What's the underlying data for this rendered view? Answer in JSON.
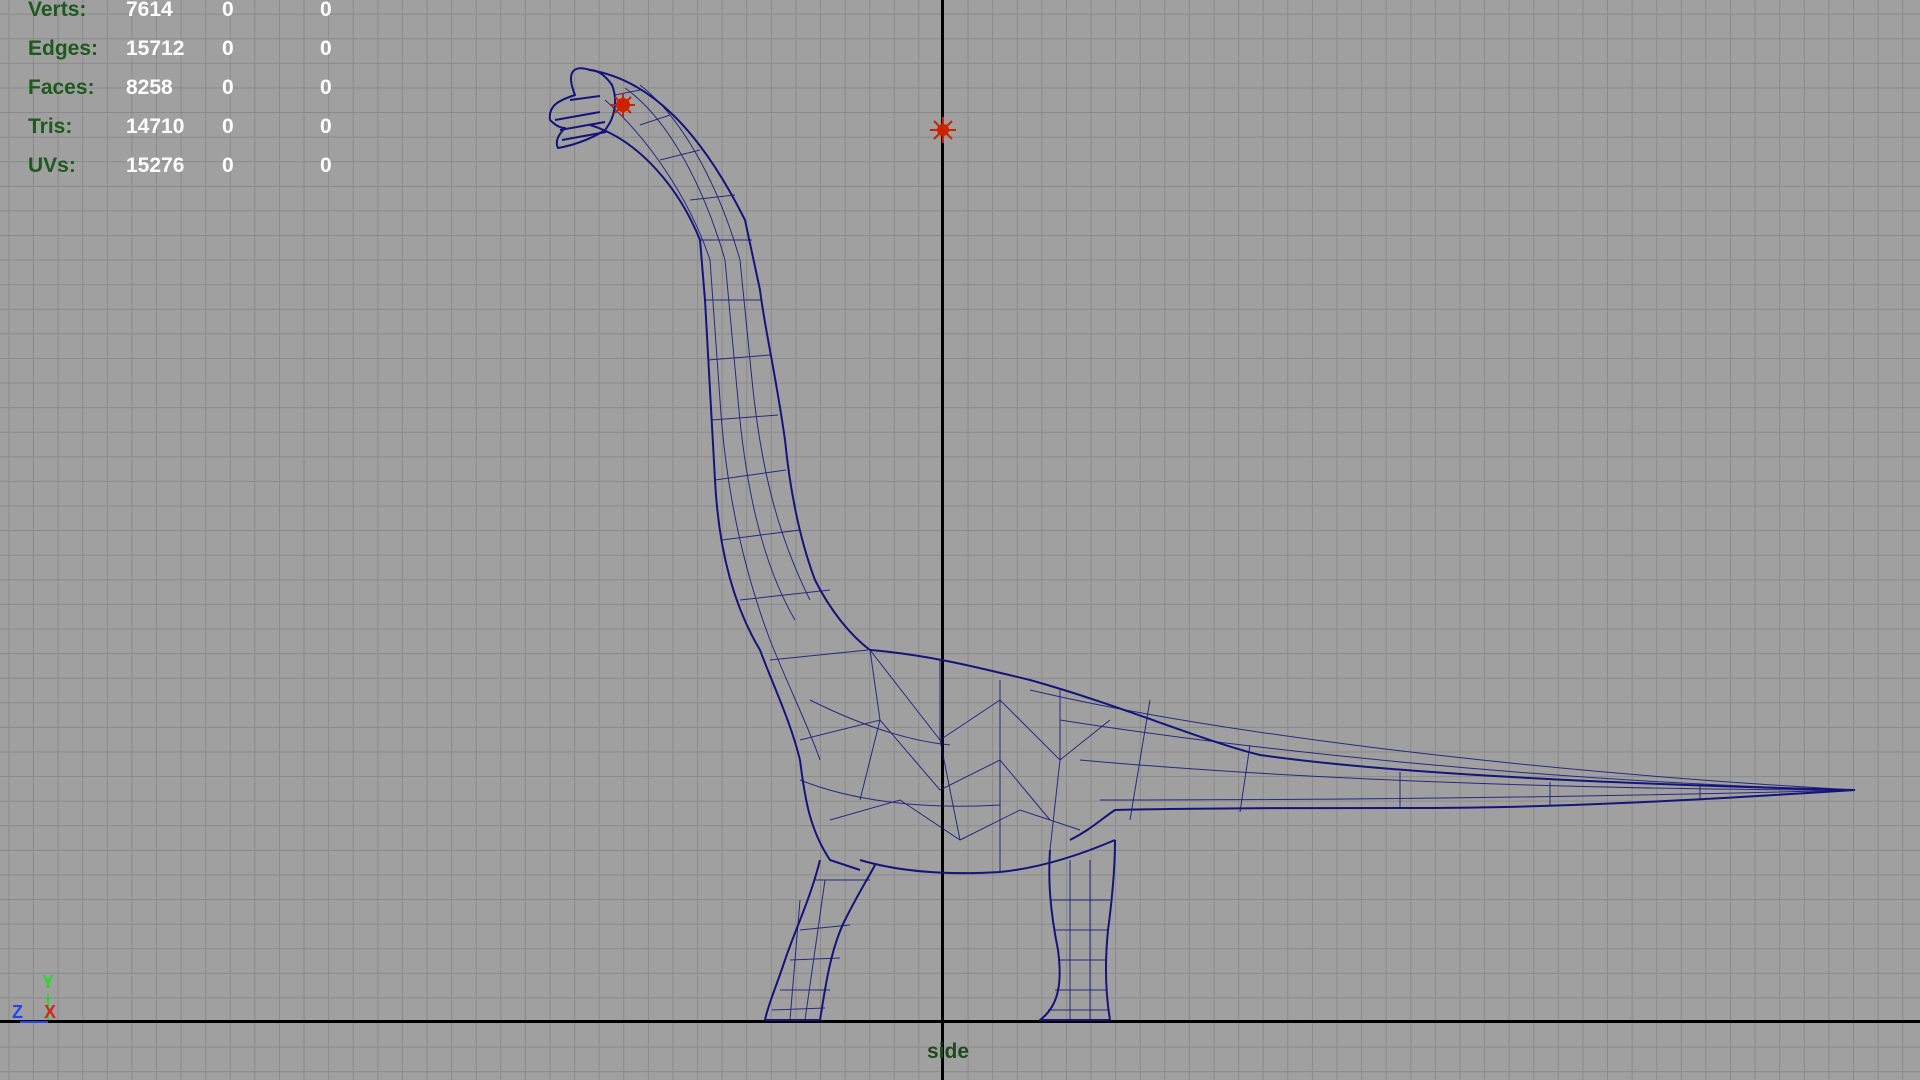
{
  "viewport": {
    "camera_name": "side",
    "grid": "on",
    "background_color": "#a0a0a0",
    "wireframe_color": "#14147a",
    "pivot_color": "#cc2200"
  },
  "hud": {
    "rows": [
      {
        "label": "Verts:",
        "total": "7614",
        "selected": "0",
        "components": "0"
      },
      {
        "label": "Edges:",
        "total": "15712",
        "selected": "0",
        "components": "0"
      },
      {
        "label": "Faces:",
        "total": "8258",
        "selected": "0",
        "components": "0"
      },
      {
        "label": "Tris:",
        "total": "14710",
        "selected": "0",
        "components": "0"
      },
      {
        "label": "UVs:",
        "total": "15276",
        "selected": "0",
        "components": "0"
      }
    ]
  },
  "axis_gizmo": {
    "y": "Y",
    "z": "Z",
    "x": "X"
  },
  "icons": {
    "world_pivot": "pivot-star-icon",
    "head_pivot": "pivot-star-icon"
  }
}
